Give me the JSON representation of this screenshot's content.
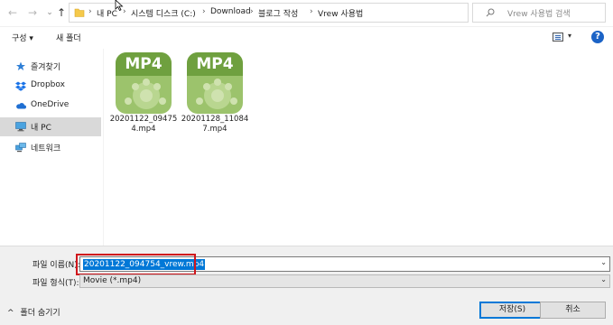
{
  "address": {
    "back_icon": "arrow-left-icon",
    "forward_icon": "arrow-right-icon",
    "up_icon": "arrow-up-icon",
    "breadcrumbs": [
      "내 PC",
      "시스템 디스크 (C:)",
      "Download",
      "블로그 작성",
      "Vrew 사용법"
    ],
    "refresh_icon": "refresh-icon"
  },
  "search": {
    "placeholder": "Vrew 사용법 검색"
  },
  "toolbar": {
    "organize_label": "구성 ▾",
    "new_folder_label": "새 폴더",
    "help_label": "?"
  },
  "sidebar": {
    "items": [
      {
        "label": "즐겨찾기",
        "icon": "star-icon",
        "selected": false
      },
      {
        "label": "Dropbox",
        "icon": "dropbox-icon",
        "selected": false
      },
      {
        "label": "OneDrive",
        "icon": "cloud-icon",
        "selected": false
      },
      {
        "label": "내 PC",
        "icon": "computer-icon",
        "selected": true
      },
      {
        "label": "네트워크",
        "icon": "network-icon",
        "selected": false
      }
    ]
  },
  "files": [
    {
      "name": "20201122_094754.mp4",
      "thumb_text": "MP4"
    },
    {
      "name": "20201128_110847.mp4",
      "thumb_text": "MP4"
    }
  ],
  "save": {
    "filename_label": "파일 이름(N):",
    "filename_value": "20201122_094754_vrew.mp4",
    "filetype_label": "파일 형식(T):",
    "filetype_value": "Movie (*.mp4)",
    "hide_folders_label": "폴더 숨기기",
    "save_button": "저장(S)",
    "cancel_button": "취소"
  },
  "colors": {
    "accent": "#0078d7",
    "highlight": "#d0161c",
    "thumb_dark": "#6fa03f",
    "thumb_light": "#9cc36c"
  }
}
